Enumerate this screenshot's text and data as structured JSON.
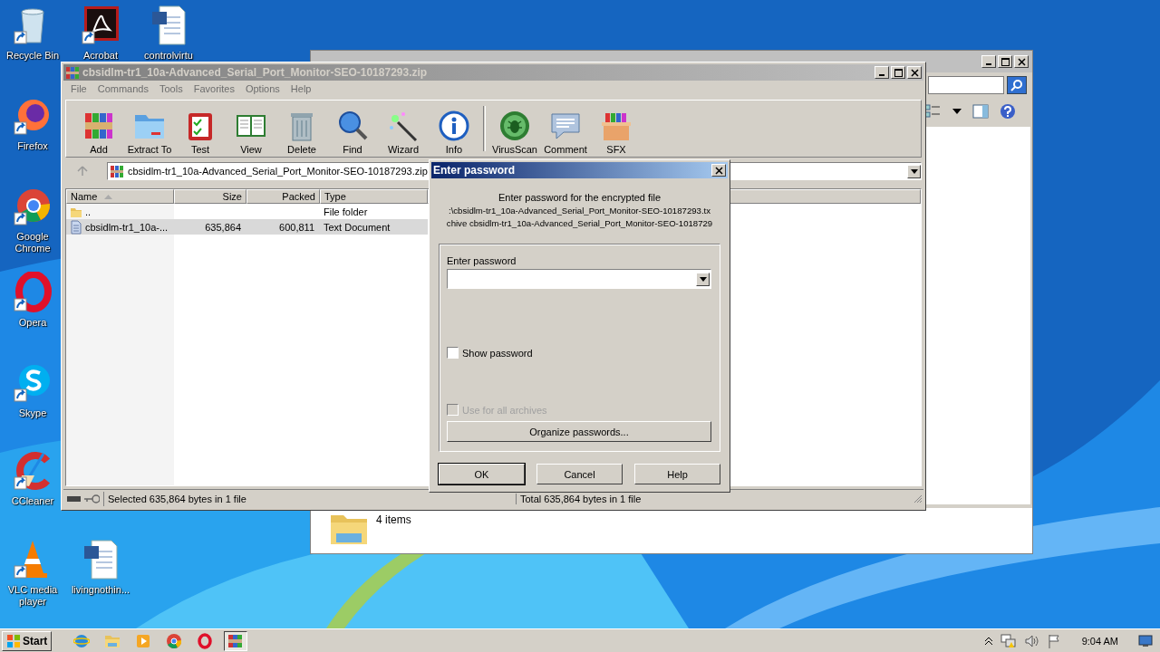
{
  "desktop_icons": [
    {
      "label": "Recycle Bin",
      "kind": "trash"
    },
    {
      "label": "Acrobat",
      "kind": "pdf"
    },
    {
      "label": "controlvirtu",
      "kind": "word"
    },
    {
      "label": "Firefox",
      "kind": "firefox"
    },
    {
      "label": "Google Chrome",
      "kind": "chrome"
    },
    {
      "label": "Opera",
      "kind": "opera"
    },
    {
      "label": "Skype",
      "kind": "skype"
    },
    {
      "label": "CCleaner",
      "kind": "ccleaner"
    },
    {
      "label": "VLC media player",
      "kind": "vlc"
    },
    {
      "label": "livingnothin...",
      "kind": "word"
    }
  ],
  "explorer": {
    "status": "4 items"
  },
  "winrar": {
    "title": "cbsidlm-tr1_10a-Advanced_Serial_Port_Monitor-SEO-10187293.zip",
    "menu": [
      "File",
      "Commands",
      "Tools",
      "Favorites",
      "Options",
      "Help"
    ],
    "toolbar": [
      {
        "label": "Add",
        "kind": "add"
      },
      {
        "label": "Extract To",
        "kind": "extract"
      },
      {
        "label": "Test",
        "kind": "test"
      },
      {
        "label": "View",
        "kind": "view"
      },
      {
        "label": "Delete",
        "kind": "delete"
      },
      {
        "label": "Find",
        "kind": "find"
      },
      {
        "label": "Wizard",
        "kind": "wizard"
      },
      {
        "label": "Info",
        "kind": "info"
      },
      {
        "label": "VirusScan",
        "kind": "virus",
        "separator_before": true
      },
      {
        "label": "Comment",
        "kind": "comment"
      },
      {
        "label": "SFX",
        "kind": "sfx"
      }
    ],
    "address": "cbsidlm-tr1_10a-Advanced_Serial_Port_Monitor-SEO-10187293.zip",
    "columns": [
      "Name",
      "Size",
      "Packed",
      "Type"
    ],
    "rows": [
      {
        "name": "..",
        "size": "",
        "packed": "",
        "type": "File folder",
        "kind": "folder",
        "selected": false
      },
      {
        "name": "cbsidlm-tr1_10a-...",
        "size": "635,864",
        "packed": "600,811",
        "type": "Text Document",
        "kind": "file",
        "selected": true
      }
    ],
    "status_left": "Selected 635,864 bytes in 1 file",
    "status_right": "Total 635,864 bytes in 1 file"
  },
  "dialog": {
    "title": "Enter password",
    "message": [
      "Enter password for the encrypted file",
      ":\\cbsidlm-tr1_10a-Advanced_Serial_Port_Monitor-SEO-10187293.tx",
      "chive cbsidlm-tr1_10a-Advanced_Serial_Port_Monitor-SEO-1018729"
    ],
    "field_label": "Enter password",
    "show_password": {
      "label": "Show password",
      "checked": false,
      "disabled": false
    },
    "use_for_all": {
      "label": "Use for all archives",
      "checked": false,
      "disabled": true
    },
    "organize": "Organize passwords...",
    "buttons": [
      {
        "label": "OK",
        "default": true
      },
      {
        "label": "Cancel",
        "default": false
      },
      {
        "label": "Help",
        "default": false
      }
    ]
  },
  "taskbar": {
    "start": "Start",
    "clock": "9:04 AM",
    "items": [
      {
        "kind": "ie",
        "selected": false
      },
      {
        "kind": "explorer",
        "selected": false
      },
      {
        "kind": "media",
        "selected": false
      },
      {
        "kind": "chrome",
        "selected": false
      },
      {
        "kind": "opera",
        "selected": false
      },
      {
        "kind": "winrar",
        "selected": true
      }
    ]
  }
}
